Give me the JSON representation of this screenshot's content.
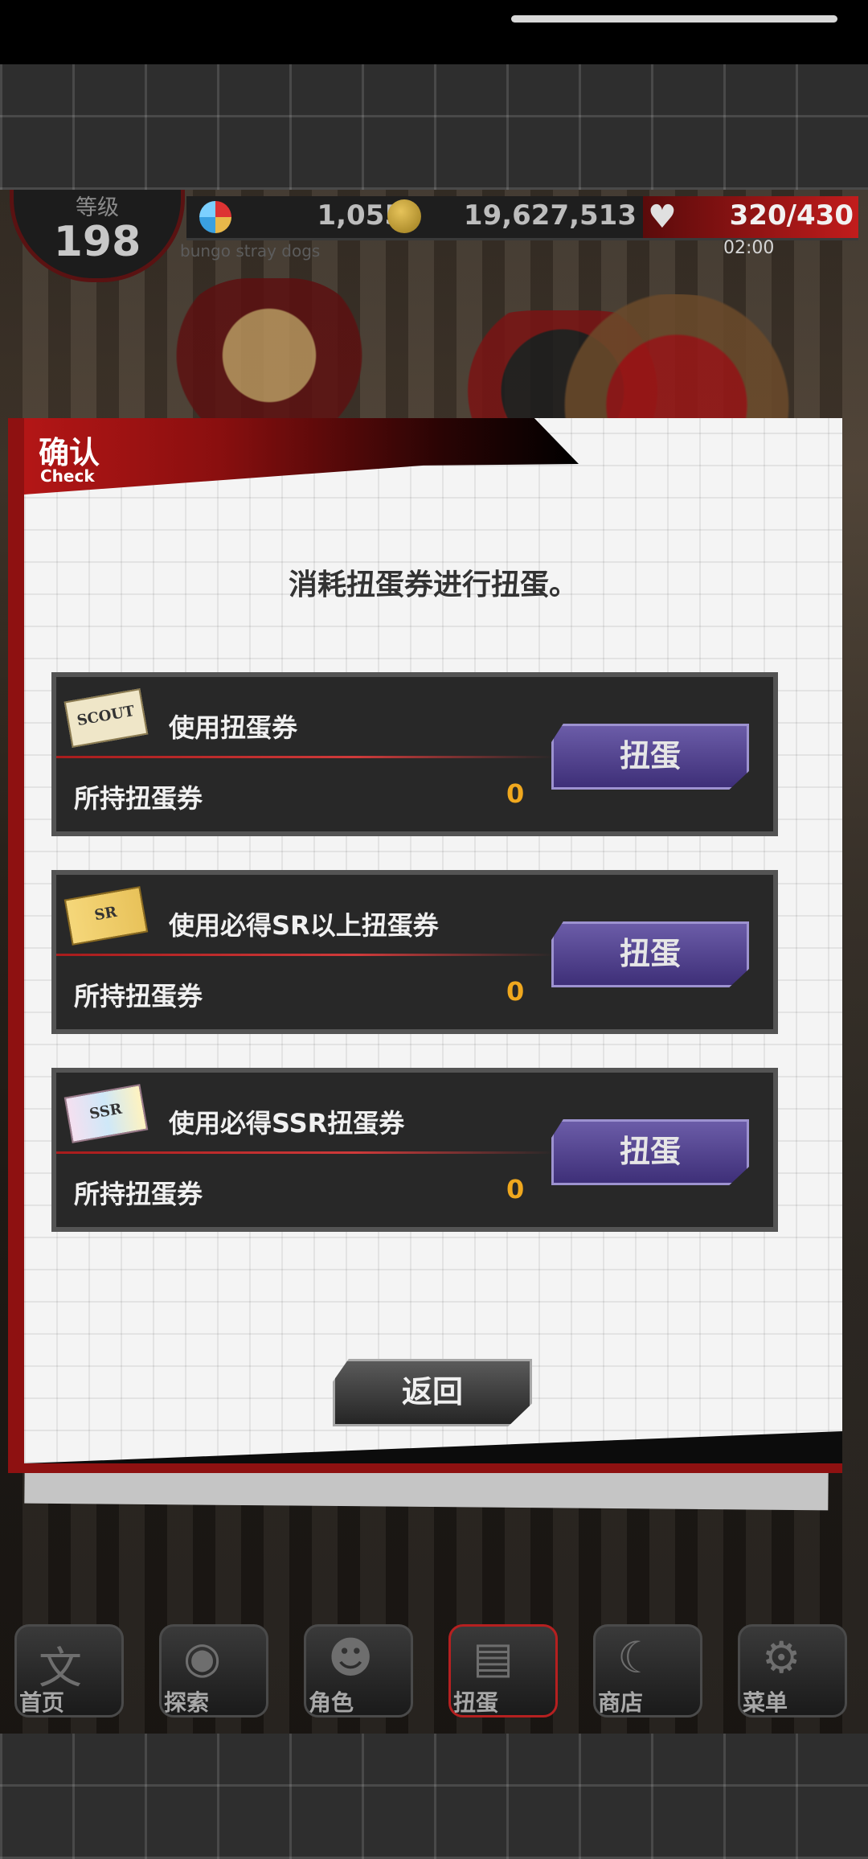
{
  "status": {
    "level_label": "等级",
    "level_value": "198",
    "gems": "1,055",
    "coins": "19,627,513",
    "stamina": "320/430",
    "stamina_timer": "02:00",
    "game_caption": "bungo stray dogs"
  },
  "dialog": {
    "title": "确认",
    "subtitle": "Check",
    "message": "消耗扭蛋券进行扭蛋。",
    "rows": [
      {
        "ticket_icon_text": "SCOUT",
        "title": "使用扭蛋券",
        "owned_label": "所持扭蛋券",
        "owned_count": "0",
        "button_label": "扭蛋"
      },
      {
        "ticket_icon_text": "SR",
        "title": "使用必得SR以上扭蛋券",
        "owned_label": "所持扭蛋券",
        "owned_count": "0",
        "button_label": "扭蛋"
      },
      {
        "ticket_icon_text": "SSR",
        "title": "使用必得SSR扭蛋券",
        "owned_label": "所持扭蛋券",
        "owned_count": "0",
        "button_label": "扭蛋"
      }
    ],
    "return_label": "返回"
  },
  "nav": {
    "items": [
      {
        "label": "首页",
        "icon": "home-icon"
      },
      {
        "label": "探索",
        "icon": "explore-icon"
      },
      {
        "label": "角色",
        "icon": "characters-icon"
      },
      {
        "label": "扭蛋",
        "icon": "gacha-icon"
      },
      {
        "label": "商店",
        "icon": "shop-icon"
      },
      {
        "label": "菜单",
        "icon": "gear-icon"
      }
    ]
  },
  "colors": {
    "accent_red": "#b31616",
    "button_purple": "#4a3b8a",
    "count_orange": "#f0a81e"
  }
}
